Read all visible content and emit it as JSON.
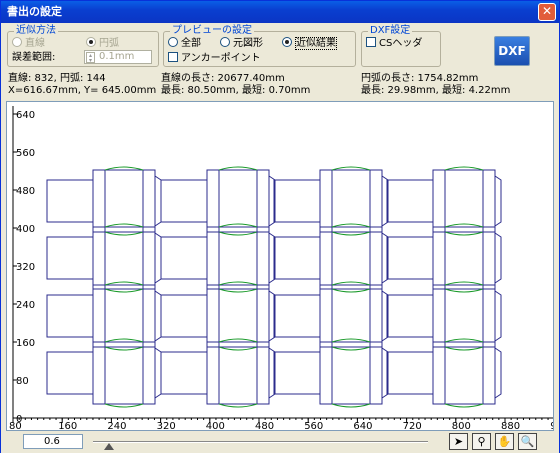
{
  "window": {
    "title": "書出の設定",
    "close_symbol": "✕"
  },
  "approx_group": {
    "title": "近似方法",
    "line_label": "直線",
    "arc_label": "円弧",
    "tolerance_label": "誤差範囲:",
    "tolerance_value": "0.1mm"
  },
  "preview_group": {
    "title": "プレビューの設定",
    "all_label": "全部",
    "original_label": "元図形",
    "approx_label": "近似結果",
    "anchor_label": "アンカーポイント",
    "selected": "近似結果"
  },
  "dxf_group": {
    "title": "DXF設定",
    "cs_header_label": "CSヘッダ",
    "button_label": "DXF"
  },
  "info": {
    "counts": "直線: 832, 円弧: 144",
    "position": "X=616.67mm, Y= 645.00mm",
    "line_length": "直線の長さ: 20677.40mm",
    "line_minmax": "最長: 80.50mm, 最短: 0.70mm",
    "arc_length": "円弧の長さ: 1754.82mm",
    "arc_minmax": "最長: 29.98mm, 最短: 4.22mm"
  },
  "axes": {
    "x_ticks": [
      "80",
      "160",
      "240",
      "320",
      "400",
      "480",
      "560",
      "640",
      "720",
      "800",
      "880",
      "9"
    ],
    "y_ticks": [
      "640",
      "560",
      "480",
      "400",
      "320",
      "240",
      "160",
      "80",
      "0"
    ]
  },
  "status": {
    "zoom": "0.6",
    "tools": [
      "arrow-tool",
      "zoom-tool",
      "hand-tool",
      "print-preview-tool"
    ]
  },
  "colors": {
    "shape_line": "#2b2b8c",
    "shape_arc": "#1a9a2a"
  }
}
